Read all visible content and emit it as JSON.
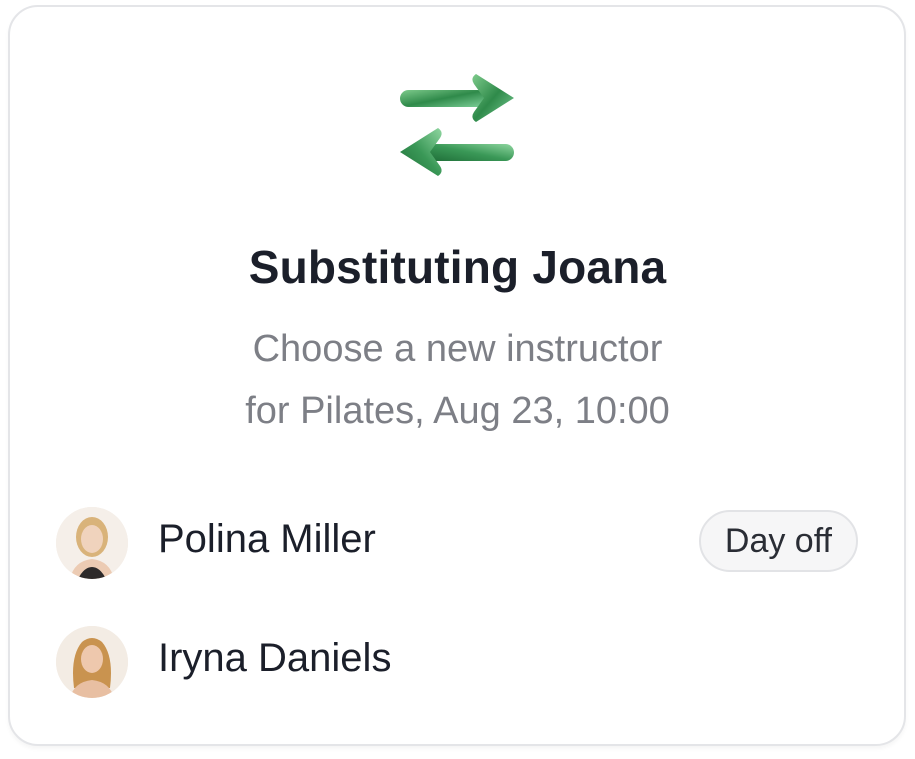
{
  "header": {
    "icon": "swap-arrows-icon",
    "title": "Substituting Joana",
    "subtitle_line1": "Choose a new instructor",
    "subtitle_line2": "for Pilates, Aug 23, 10:00"
  },
  "instructors": [
    {
      "name": "Polina Miller",
      "avatar": "avatar-icon",
      "badge": "Day off"
    },
    {
      "name": "Iryna Daniels",
      "avatar": "avatar-icon",
      "badge": ""
    }
  ],
  "colors": {
    "title": "#1b1f2a",
    "subtitle": "#7d7f86",
    "icon_green": "#3f9a5c",
    "badge_bg": "#f6f6f7",
    "card_border": "#e4e5e8"
  }
}
